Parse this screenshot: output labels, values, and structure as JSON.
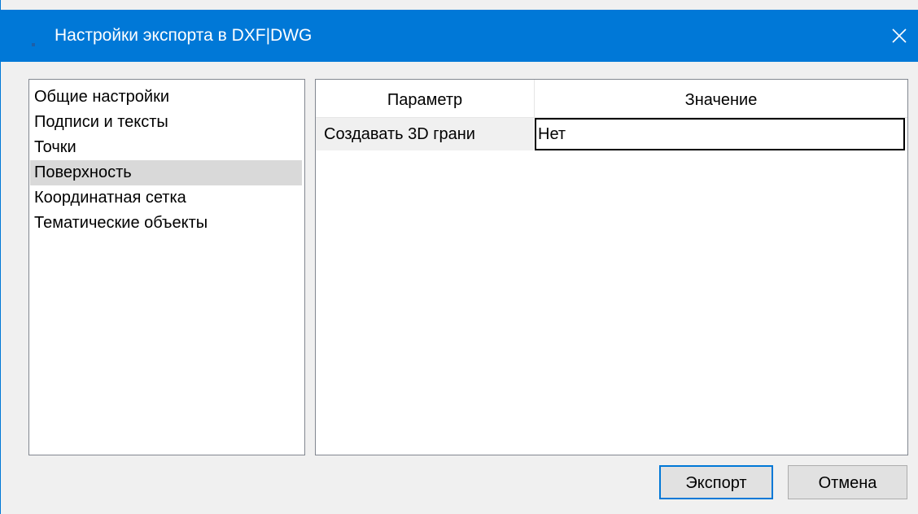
{
  "window": {
    "title": "Настройки экспорта в DXF|DWG",
    "accent_color": "#0078d7",
    "close_icon": "close-icon"
  },
  "sidebar": {
    "selected_index": 3,
    "items": [
      {
        "label": "Общие настройки"
      },
      {
        "label": "Подписи и тексты"
      },
      {
        "label": "Точки"
      },
      {
        "label": "Поверхность"
      },
      {
        "label": "Координатная сетка"
      },
      {
        "label": "Тематические объекты"
      }
    ]
  },
  "table": {
    "headers": {
      "param": "Параметр",
      "value": "Значение"
    },
    "rows": [
      {
        "param": "Создавать 3D грани",
        "value": "Нет"
      }
    ]
  },
  "buttons": {
    "export_label": "Экспорт",
    "cancel_label": "Отмена"
  }
}
